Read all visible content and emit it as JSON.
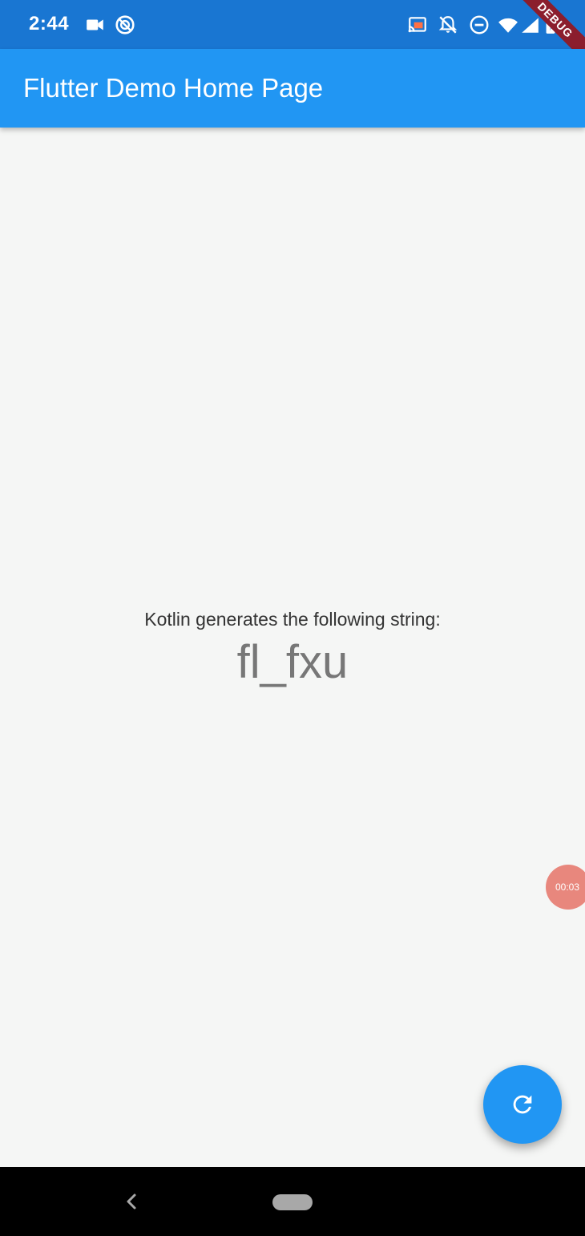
{
  "status_bar": {
    "time": "2:44",
    "icons": [
      "video-camera-icon",
      "do-not-disturb-app-icon",
      "cast-icon",
      "notifications-off-icon",
      "do-not-disturb-icon",
      "wifi-icon",
      "signal-icon",
      "battery-icon"
    ]
  },
  "debug_banner": {
    "label": "DEBUG"
  },
  "app_bar": {
    "title": "Flutter Demo Home Page"
  },
  "main": {
    "caption": "Kotlin generates the following string:",
    "result": "fl_fxu"
  },
  "overlay": {
    "timer": "00:03"
  },
  "fab": {
    "icon": "refresh-icon"
  },
  "nav_bar": {
    "icons": [
      "back-icon",
      "home-pill-icon"
    ]
  },
  "colors": {
    "status_bar": "#1976d2",
    "app_bar": "#2196f3",
    "fab": "#2196f3",
    "background": "#f5f6f5",
    "timer_bubble": "#e8877d",
    "debug_banner": "#8b1e2d"
  }
}
